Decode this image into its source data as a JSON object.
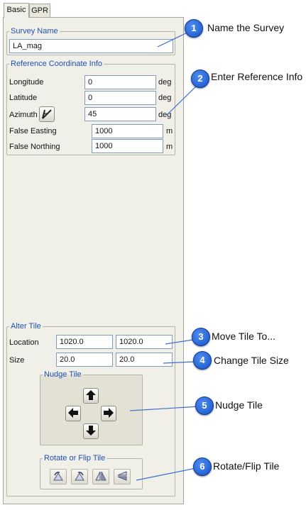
{
  "tabs": [
    {
      "label": "Basic"
    },
    {
      "label": "GPR"
    }
  ],
  "survey": {
    "legend": "Survey Name",
    "value": "LA_mag"
  },
  "ref": {
    "legend": "Reference Coordinate Info",
    "rows": [
      {
        "label": "Longitude",
        "value": "0",
        "unit": "deg"
      },
      {
        "label": "Latitude",
        "value": "0",
        "unit": "deg"
      },
      {
        "label": "Azimuth",
        "value": "45",
        "unit": "deg"
      },
      {
        "label": "False Easting",
        "value": "1000",
        "unit": "m"
      },
      {
        "label": "False Northing",
        "value": "1000",
        "unit": "m"
      }
    ]
  },
  "alter": {
    "legend": "Alter Tile",
    "location": {
      "label": "Location",
      "x": "1020.0",
      "y": "1020.0"
    },
    "size": {
      "label": "Size",
      "x": "20.0",
      "y": "20.0"
    }
  },
  "nudge": {
    "legend": "Nudge Tile"
  },
  "rotate": {
    "legend": "Rotate or Flip Tile"
  },
  "callouts": [
    {
      "num": "1",
      "text": "Name the Survey"
    },
    {
      "num": "2",
      "text": "Enter Reference Info"
    },
    {
      "num": "3",
      "text": "Move Tile To..."
    },
    {
      "num": "4",
      "text": "Change Tile Size"
    },
    {
      "num": "5",
      "text": "Nudge Tile"
    },
    {
      "num": "6",
      "text": "Rotate/Flip Tile"
    }
  ],
  "colors": {
    "badge": "#1f66d8",
    "legend": "#1f4fb5",
    "panel": "#f0efe8"
  }
}
